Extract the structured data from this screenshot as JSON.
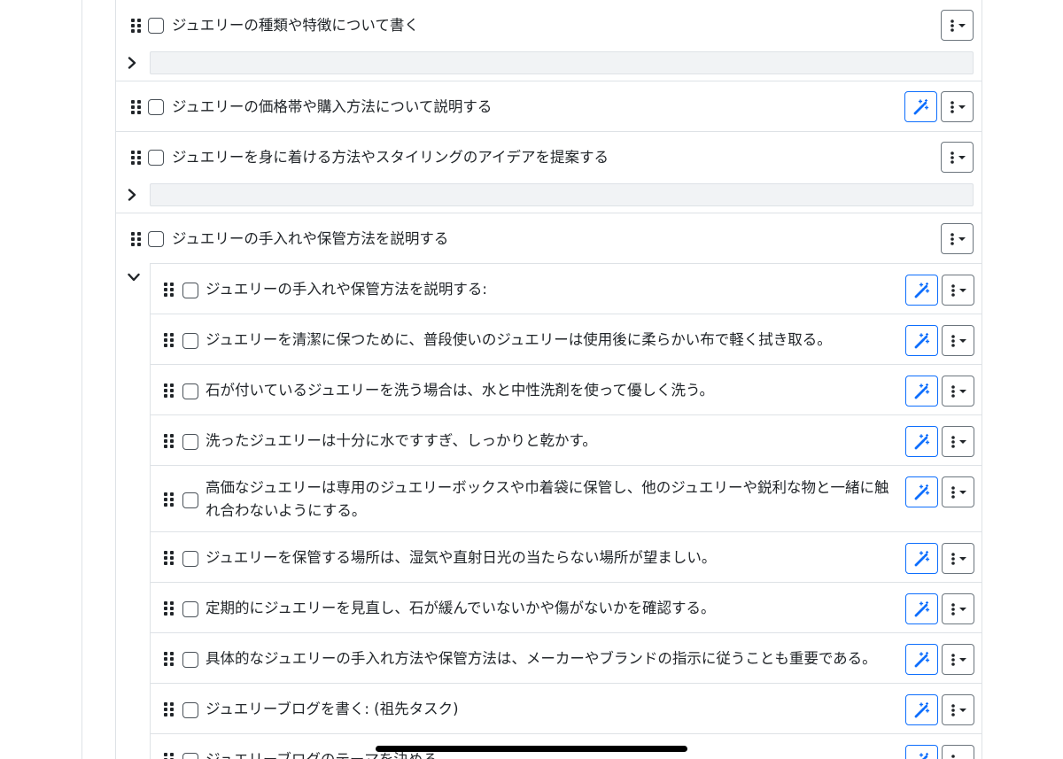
{
  "tasks": [
    {
      "label": "ジュエリーの種類や特徴について書く",
      "checked": false,
      "has_magic": false
    },
    {
      "label": "ジュエリーの価格帯や購入方法について説明する",
      "checked": false,
      "has_magic": true
    },
    {
      "label": "ジュエリーを身に着ける方法やスタイリングのアイデアを提案する",
      "checked": false,
      "has_magic": false
    },
    {
      "label": "ジュエリーの手入れや保管方法を説明する",
      "checked": false,
      "has_magic": false,
      "expanded": true
    }
  ],
  "subtasks": [
    {
      "label": "ジュエリーの手入れや保管方法を説明する:",
      "checked": false
    },
    {
      "label": "ジュエリーを清潔に保つために、普段使いのジュエリーは使用後に柔らかい布で軽く拭き取る。",
      "checked": false
    },
    {
      "label": "石が付いているジュエリーを洗う場合は、水と中性洗剤を使って優しく洗う。",
      "checked": false
    },
    {
      "label": "洗ったジュエリーは十分に水ですすぎ、しっかりと乾かす。",
      "checked": false
    },
    {
      "label": "高価なジュエリーは専用のジュエリーボックスや巾着袋に保管し、他のジュエリーや鋭利な物と一緒に触れ合わないようにする。",
      "checked": false
    },
    {
      "label": "ジュエリーを保管する場所は、湿気や直射日光の当たらない場所が望ましい。",
      "checked": false
    },
    {
      "label": "定期的にジュエリーを見直し、石が緩んでいないかや傷がないかを確認する。",
      "checked": false
    },
    {
      "label": "具体的なジュエリーの手入れ方法や保管方法は、メーカーやブランドの指示に従うことも重要である。",
      "checked": false
    },
    {
      "label": "ジュエリーブログを書く: (祖先タスク)",
      "checked": false
    },
    {
      "label": "ジュエリーブログのテーマを決める",
      "checked": false
    }
  ],
  "colors": {
    "accent": "#0d6efd",
    "border": "#dee2e6",
    "text": "#212529"
  },
  "icons": {
    "drag": "drag-handle-icon",
    "magic": "magic-wand-icon",
    "menu": "kebab-menu-icon",
    "caret": "caret-down-icon",
    "collapsed": "chevron-right-icon",
    "expanded": "chevron-down-icon"
  }
}
